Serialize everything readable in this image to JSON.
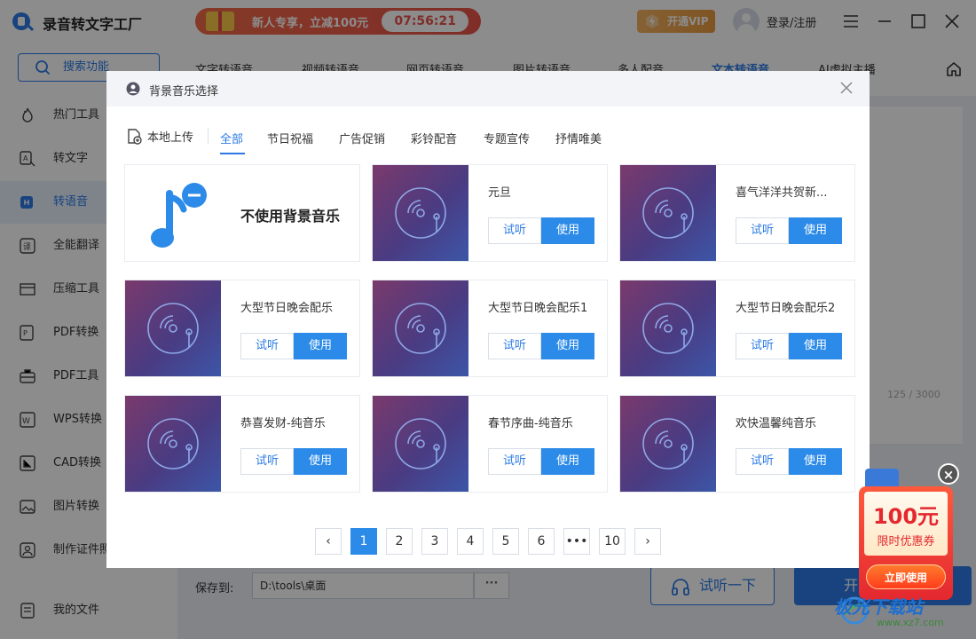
{
  "app": {
    "title": "录音转文字工厂",
    "promo_text": "新人专享，立减100元",
    "promo_timer": "07:56:21",
    "vip_label": "开通VIP",
    "login_label": "登录/注册"
  },
  "sidebar": {
    "search_label": "搜索功能",
    "items": [
      {
        "label": "热门工具",
        "icon": "flame-icon"
      },
      {
        "label": "转文字",
        "icon": "text-convert-icon"
      },
      {
        "label": "转语音",
        "icon": "voice-icon"
      },
      {
        "label": "全能翻译",
        "icon": "translate-icon"
      },
      {
        "label": "压缩工具",
        "icon": "compress-icon"
      },
      {
        "label": "PDF转换",
        "icon": "pdf-convert-icon"
      },
      {
        "label": "PDF工具",
        "icon": "toolbox-icon"
      },
      {
        "label": "WPS转换",
        "icon": "wps-icon"
      },
      {
        "label": "CAD转换",
        "icon": "cad-icon"
      },
      {
        "label": "图片转换",
        "icon": "image-icon"
      },
      {
        "label": "制作证件照",
        "icon": "id-photo-icon"
      },
      {
        "label": "我的文件",
        "icon": "file-icon"
      }
    ],
    "active_index": 2
  },
  "main_tabs": [
    "文字转语音",
    "视频转语音",
    "网页转语音",
    "图片转语音",
    "多人配音",
    "文本转语音",
    "AI虚拟主播"
  ],
  "main_active_tab": 5,
  "counter": "125 / 3000",
  "bottom": {
    "save_label": "保存到:",
    "save_path": "D:\\tools\\桌面",
    "more_label": "···",
    "listen_label": "试听一下",
    "start_label": "开"
  },
  "dialog": {
    "title": "背景音乐选择",
    "upload_label": "本地上传",
    "categories": [
      "全部",
      "节日祝福",
      "广告促销",
      "彩铃配音",
      "专题宣传",
      "抒情唯美"
    ],
    "active_category": 0,
    "no_music_label": "不使用背景音乐",
    "listen_label": "试听",
    "use_label": "使用",
    "tracks": [
      "元旦",
      "喜气洋洋共贺新...",
      "大型节日晚会配乐",
      "大型节日晚会配乐1",
      "大型节日晚会配乐2",
      "恭喜发财-纯音乐",
      "春节序曲-纯音乐",
      "欢快温馨纯音乐"
    ],
    "pagination": {
      "pages": [
        "1",
        "2",
        "3",
        "4",
        "5",
        "6",
        "•••",
        "10"
      ],
      "current": "1",
      "prev": "‹",
      "next": "›"
    }
  },
  "coupon": {
    "amount": "100元",
    "label": "限时优惠券",
    "button": "立即使用",
    "close": "×"
  },
  "watermark": {
    "text": "极光下载站",
    "sub": "www.xz7.com"
  }
}
